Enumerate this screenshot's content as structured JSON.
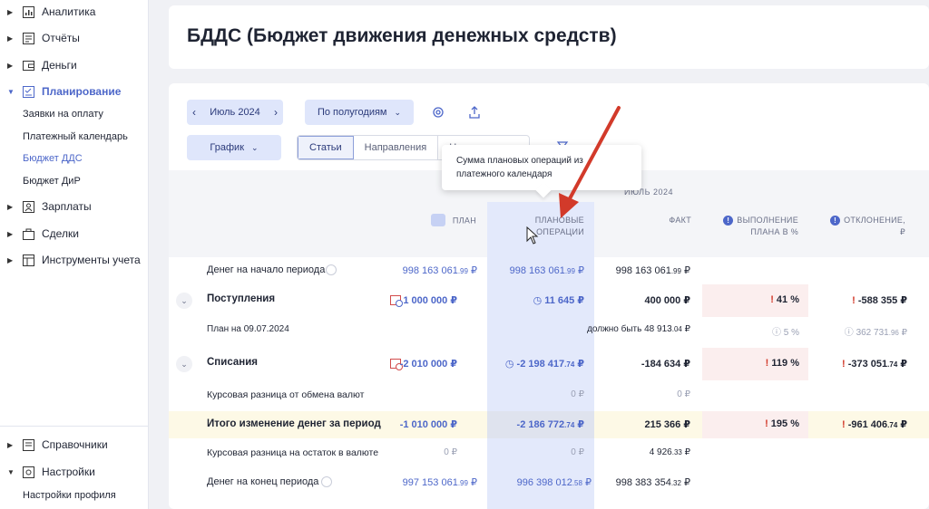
{
  "sidebar": {
    "items": [
      {
        "label": "Аналитика",
        "icon": "chart-icon"
      },
      {
        "label": "Отчёты",
        "icon": "report-icon"
      },
      {
        "label": "Деньги",
        "icon": "wallet-icon"
      },
      {
        "label": "Планирование",
        "icon": "planning-icon",
        "active": true
      }
    ],
    "sub_items": [
      "Заявки на оплату",
      "Платежный календарь",
      "Бюджет ДДС",
      "Бюджет ДиР"
    ],
    "items2": [
      {
        "label": "Зарплаты",
        "icon": "person-icon"
      },
      {
        "label": "Сделки",
        "icon": "briefcase-icon"
      },
      {
        "label": "Инструменты учета",
        "icon": "table-icon"
      }
    ],
    "bottom_items": [
      {
        "label": "Справочники",
        "icon": "book-icon"
      },
      {
        "label": "Настройки",
        "icon": "settings-icon"
      }
    ],
    "bottom_sub": "Настройки профиля",
    "active_color": "#4d67c9"
  },
  "header": {
    "title": "БДДС (Бюджет движения денежных средств)"
  },
  "toolbar": {
    "period": "Июль 2024",
    "grouping": "По полугодиям",
    "chart": "График",
    "tabs": [
      "Статьи",
      "Направления",
      "На"
    ]
  },
  "tooltip": {
    "text": "Сумма плановых операций из платежного календаря"
  },
  "table": {
    "month": "ИЮЛЬ 2024",
    "headers": {
      "plan": "ПЛАН",
      "planned_ops_1": "ПЛАНОВЫЕ",
      "planned_ops_2": "ОПЕРАЦИИ",
      "fact": "ФАКТ",
      "exec_1": "ВЫПОЛНЕНИЕ",
      "exec_2": "ПЛАНА В %",
      "dev": "ОТКЛОНЕНИЕ, ₽"
    },
    "rows": {
      "start": {
        "label": "Денег на начало периода",
        "plan_main": "998 163 061",
        "plan_dec": ".99",
        "planned_main": "998 163 061",
        "planned_dec": ".99",
        "fact_main": "998 163 061",
        "fact_dec": ".99"
      },
      "income": {
        "label": "Поступления",
        "plan": "1 000 000 ₽",
        "planned": "11 645 ₽",
        "fact": "400 000 ₽",
        "exec": "41 %",
        "dev": "-588 355 ₽"
      },
      "income_sub": {
        "label": "План на 09.07.2024",
        "fact_prefix": "должно быть",
        "fact_main": "48 913",
        "fact_dec": ".04",
        "exec": "5 %",
        "dev_main": "362 731",
        "dev_dec": ".96"
      },
      "expense": {
        "label": "Списания",
        "plan": "-2 010 000 ₽",
        "planned_main": "-2 198 417",
        "planned_dec": ".74",
        "fact": "-184 634 ₽",
        "exec": "119 %",
        "dev_main": "-373 051",
        "dev_dec": ".74"
      },
      "fx": {
        "label": "Курсовая разница от обмена валют",
        "planned": "0 ₽",
        "fact": "0 ₽"
      },
      "total": {
        "label": "Итого изменение денег за период",
        "plan": "-1 010 000 ₽",
        "planned_main": "-2 186 772",
        "planned_dec": ".74",
        "fact": "215 366 ₽",
        "exec": "195 %",
        "dev_main": "-961 406",
        "dev_dec": ".74"
      },
      "fx_rest": {
        "label": "Курсовая разница на остаток в валюте",
        "plan": "0 ₽",
        "planned": "0 ₽",
        "fact_main": "4 926",
        "fact_dec": ".33"
      },
      "end": {
        "label": "Денег на конец периода",
        "plan_main": "997 153 061",
        "plan_dec": ".99",
        "planned_main": "996 398 012",
        "planned_dec": ".58",
        "fact_main": "998 383 354",
        "fact_dec": ".32"
      }
    },
    "rub": "₽",
    "excl": "!"
  },
  "colors": {
    "accent": "#4d67c9",
    "highlight": "#e3e9fb",
    "warn": "#fbeeee",
    "total_bg": "#fdf9e6",
    "arrow": "#d23a2a"
  }
}
